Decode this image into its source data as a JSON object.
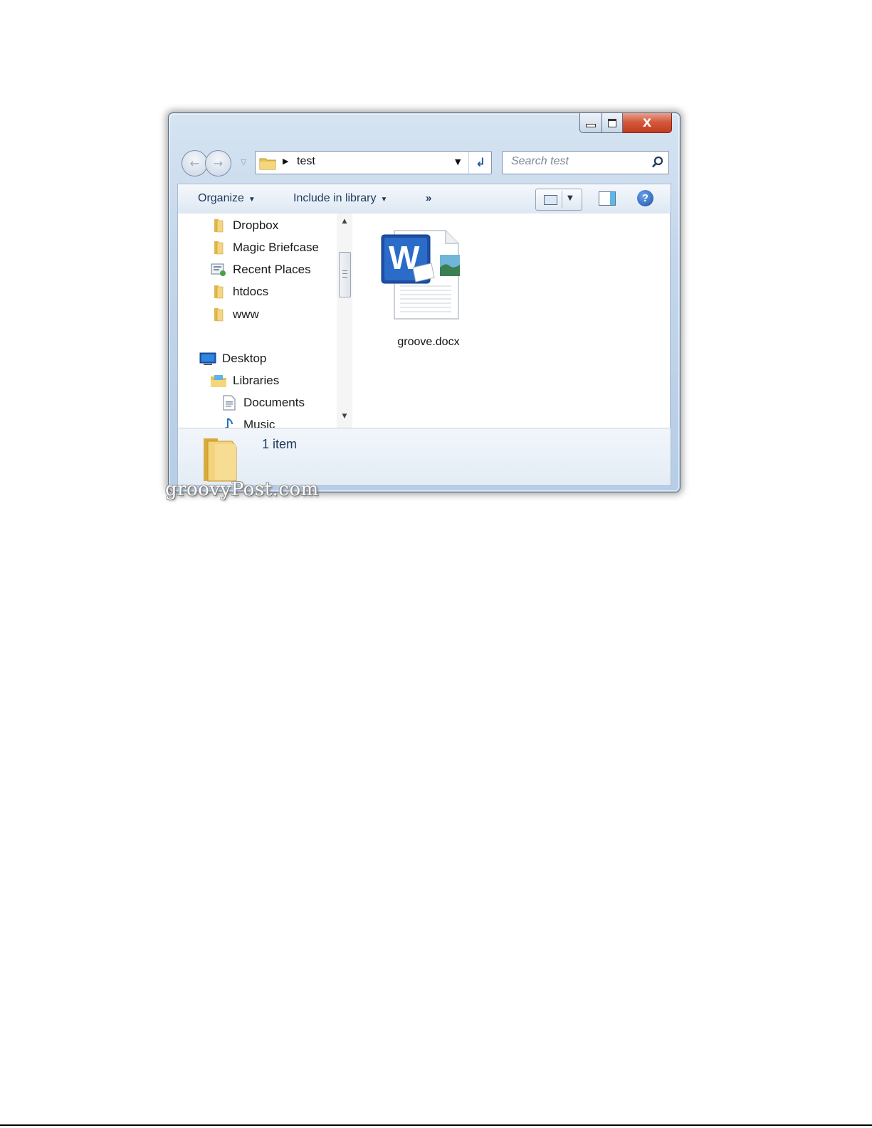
{
  "window": {
    "controls": {
      "minimize_icon": "minimize-icon",
      "maximize_icon": "maximize-icon",
      "close_glyph": "X"
    }
  },
  "navigation": {
    "back_icon": "back-arrow-icon",
    "forward_icon": "forward-arrow-icon",
    "recent_glyph": "▽"
  },
  "address_bar": {
    "path": "test",
    "refresh_glyph": "↲"
  },
  "search": {
    "placeholder": "Search test"
  },
  "toolbar": {
    "organize": "Organize",
    "include_in_library": "Include in library",
    "more": "»",
    "help_glyph": "?"
  },
  "nav_pane": {
    "items": [
      {
        "label": "Dropbox",
        "icon": "folder-icon"
      },
      {
        "label": "Magic Briefcase",
        "icon": "folder-icon"
      },
      {
        "label": "Recent Places",
        "icon": "recent-places-icon"
      },
      {
        "label": "htdocs",
        "icon": "folder-icon"
      },
      {
        "label": "www",
        "icon": "folder-icon"
      },
      {
        "label": "Desktop",
        "icon": "desktop-icon"
      },
      {
        "label": "Libraries",
        "icon": "libraries-icon"
      },
      {
        "label": "Documents",
        "icon": "documents-icon"
      },
      {
        "label": "Music",
        "icon": "music-icon"
      }
    ]
  },
  "files": [
    {
      "name": "groove.docx",
      "icon": "word-document-icon"
    }
  ],
  "details": {
    "count": "1 item"
  },
  "watermark": "groovyPost.com",
  "colors": {
    "close_button": "#c8452a",
    "toolbar_text": "#1e395b",
    "frame": "#c3d6ea"
  }
}
